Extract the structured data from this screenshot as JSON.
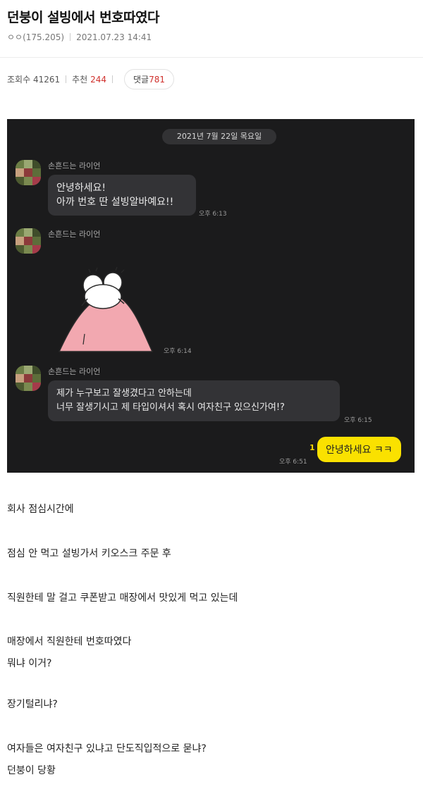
{
  "post": {
    "title": "던붕이 설빙에서 번호따였다",
    "author": "ㅇㅇ(175.205)",
    "datetime": "2021.07.23 14:41",
    "views_label": "조회수",
    "views": "41261",
    "recommend_label": "추천",
    "recommend": "244",
    "comment_label": "댓글",
    "comment_count": "781"
  },
  "chat": {
    "date": "2021년 7월 22일 목요일",
    "messages": [
      {
        "sender": "손흔드는 라이언",
        "text": "안녕하세요!\n아까 번호 딴 설빙알바예요!!",
        "time": "오후 6:13"
      },
      {
        "sender": "손흔드는 라이언",
        "type": "sticker",
        "time": "오후 6:14"
      },
      {
        "sender": "손흔드는 라이언",
        "text": "제가 누구보고 잘생겼다고 안하는데\n너무 잘생기시고 제 타입이셔서 혹시 여자친구 있으신가여!?",
        "time": "오후 6:15"
      }
    ],
    "reply": {
      "text": "안녕하세요 ㅋㅋ",
      "time": "오후 6:51",
      "unread": "1"
    }
  },
  "body": [
    "회사 점심시간에",
    "점심 안 먹고 설빙가서 키오스크 주문 후",
    "직원한테 말 걸고 쿠폰받고 매장에서 맛있게 먹고 있는데",
    "매장에서 직원한테 번호따였다",
    "뭐냐 이거?",
    "장기털리냐?",
    "여자들은 여자친구 있냐고 단도직입적으로 묻냐?",
    "던붕이 당황"
  ],
  "colors": {
    "chat_bg": "#1b1b1c",
    "bubble_other": "#333336",
    "bubble_mine": "#fae100",
    "accent_red": "#d0312d"
  }
}
